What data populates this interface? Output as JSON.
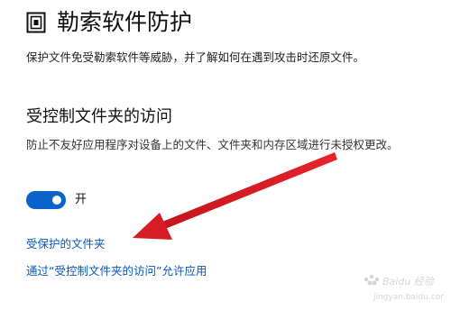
{
  "header": {
    "icon": "ransomware-protection-icon",
    "title": "勒索软件防护",
    "description": "保护文件免受勒索软件等威胁，并了解如何在遇到攻击时还原文件。"
  },
  "controlled_folder_access": {
    "title": "受控制文件夹的访问",
    "description": "防止不友好应用程序对设备上的文件、文件夹和内存区域进行未授权更改。",
    "toggle": {
      "state": "on",
      "label": "开",
      "color": "#0a63c8"
    }
  },
  "links": {
    "protected_folders": "受保护的文件夹",
    "allow_app": "通过“受控制文件夹的访问”允许应用"
  },
  "annotation": {
    "arrow_color": "#e0202a"
  },
  "watermark": {
    "brand": "Baidu 经验",
    "url": "jingyan.baidu.com"
  },
  "colors": {
    "link": "#0a58b8",
    "accent": "#0a63c8"
  }
}
